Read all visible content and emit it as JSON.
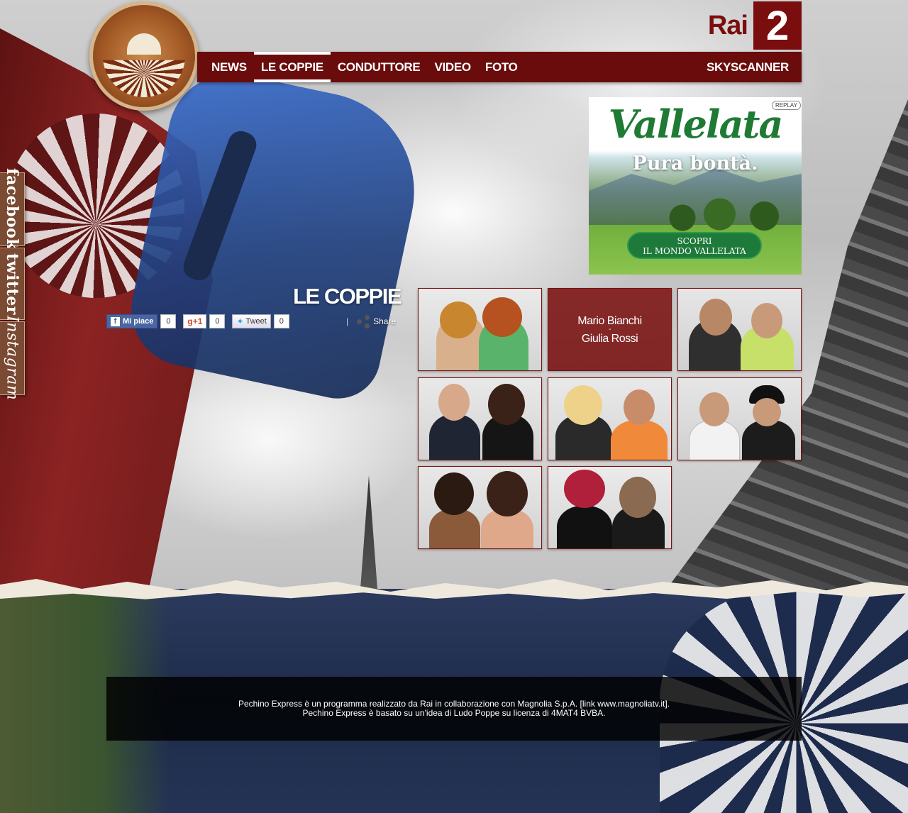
{
  "header": {
    "channel_word": "Rai",
    "channel_number": "2"
  },
  "nav": {
    "items": [
      {
        "label": "NEWS",
        "active": false
      },
      {
        "label": "LE COPPIE",
        "active": true
      },
      {
        "label": "CONDUTTORE",
        "active": false
      },
      {
        "label": "VIDEO",
        "active": false
      },
      {
        "label": "FOTO",
        "active": false
      }
    ],
    "right_item": "SKYSCANNER"
  },
  "social_tabs": [
    "facebook",
    "twitter",
    "Instagram"
  ],
  "ad": {
    "brand": "Vallelata",
    "tagline": "Pura bontà.",
    "replay_label": "REPLAY",
    "cta_line1": "SCOPRI",
    "cta_line2": "IL MONDO VALLELATA"
  },
  "section": {
    "title": "LE COPPIE"
  },
  "social_buttons": {
    "like_label": "Mi piace",
    "like_count": "0",
    "gplus_label": "+1",
    "gplus_count": "0",
    "tweet_label": "Tweet",
    "tweet_count": "0",
    "share_separator": "|",
    "share_label": "Share"
  },
  "couples": [
    {
      "id": 1,
      "hover_name1": "",
      "hover_name2": ""
    },
    {
      "id": 2,
      "hover_name1": "Mario Bianchi",
      "hover_name2": "Giulia Rossi",
      "hover_dash": "-"
    },
    {
      "id": 3,
      "hover_name1": "",
      "hover_name2": ""
    },
    {
      "id": 4,
      "hover_name1": "",
      "hover_name2": ""
    },
    {
      "id": 5,
      "hover_name1": "",
      "hover_name2": ""
    },
    {
      "id": 6,
      "hover_name1": "",
      "hover_name2": ""
    },
    {
      "id": 7,
      "hover_name1": "",
      "hover_name2": ""
    },
    {
      "id": 8,
      "hover_name1": "",
      "hover_name2": ""
    }
  ],
  "footer": {
    "line1": "Pechino Express è un programma realizzato da Rai in collaborazione con Magnolia S.p.A. [link www.magnoliatv.it].",
    "line2": "Pechino Express è basato su un'idea di Ludo Poppe su licenza di 4MAT4 BVBA."
  },
  "colors": {
    "brand_red": "#6b0c0c",
    "rai_red": "#7a0d0d",
    "ad_green": "#1f7a34"
  }
}
